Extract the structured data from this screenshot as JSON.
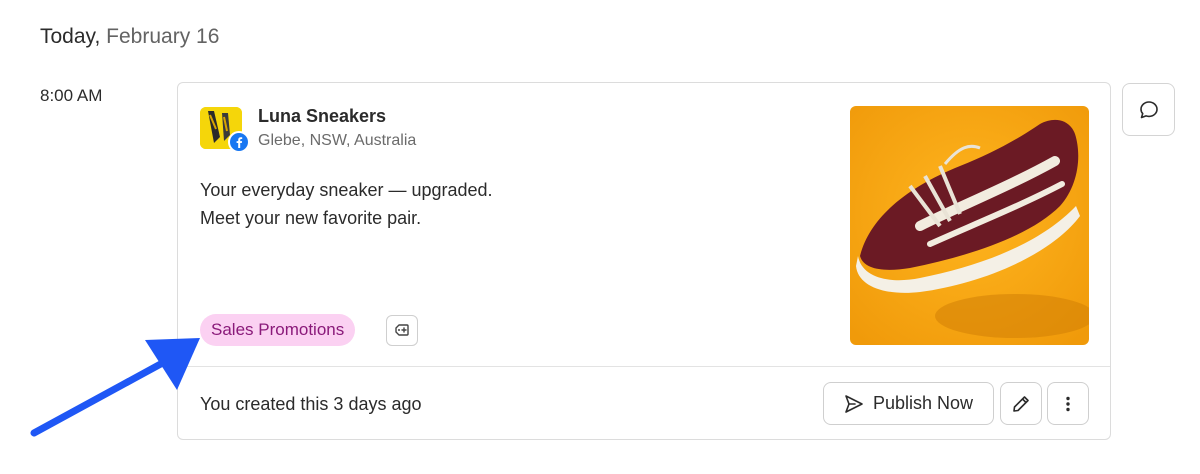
{
  "header": {
    "today_label": "Today,",
    "date_label": "February 16"
  },
  "schedule": {
    "time": "8:00 AM"
  },
  "post": {
    "account_name": "Luna Sneakers",
    "location": "Glebe, NSW, Australia",
    "network": "facebook",
    "text_lines": [
      "Your everyday sneaker — upgraded.",
      "Meet your new favorite pair."
    ],
    "tag_label": "Sales Promotions",
    "created_text": "You created this 3 days ago"
  },
  "actions": {
    "publish_label": "Publish Now"
  },
  "colors": {
    "tag_bg": "#fbd1f2",
    "tag_text": "#8a1a7a",
    "facebook_blue": "#1877f2",
    "image_bg": "#f4a614",
    "annotation_arrow": "#1f57f5"
  },
  "icons": {
    "comment": "comment-icon",
    "add_tag": "tag-plus-icon",
    "publish": "send-icon",
    "edit": "pencil-icon",
    "more": "more-vertical-icon",
    "network": "facebook-icon"
  }
}
